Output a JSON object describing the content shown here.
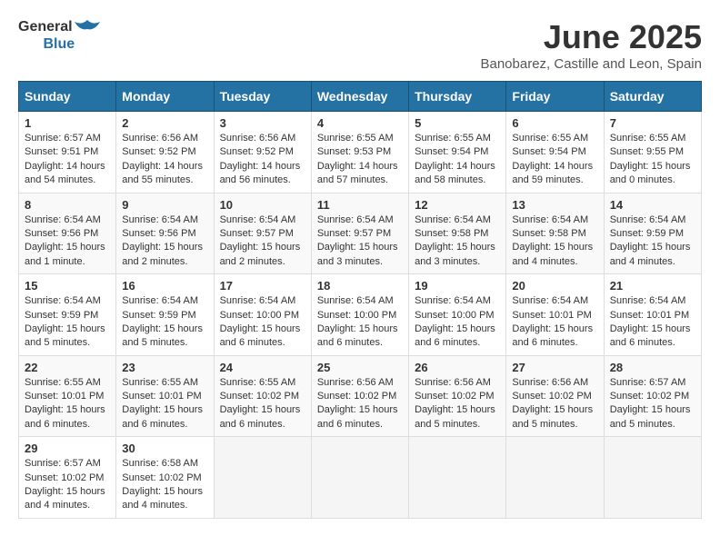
{
  "logo": {
    "general": "General",
    "blue": "Blue"
  },
  "title": "June 2025",
  "subtitle": "Banobarez, Castille and Leon, Spain",
  "days_header": [
    "Sunday",
    "Monday",
    "Tuesday",
    "Wednesday",
    "Thursday",
    "Friday",
    "Saturday"
  ],
  "weeks": [
    [
      {
        "day": "1",
        "sunrise": "6:57 AM",
        "sunset": "9:51 PM",
        "daylight": "14 hours and 54 minutes."
      },
      {
        "day": "2",
        "sunrise": "6:56 AM",
        "sunset": "9:52 PM",
        "daylight": "14 hours and 55 minutes."
      },
      {
        "day": "3",
        "sunrise": "6:56 AM",
        "sunset": "9:52 PM",
        "daylight": "14 hours and 56 minutes."
      },
      {
        "day": "4",
        "sunrise": "6:55 AM",
        "sunset": "9:53 PM",
        "daylight": "14 hours and 57 minutes."
      },
      {
        "day": "5",
        "sunrise": "6:55 AM",
        "sunset": "9:54 PM",
        "daylight": "14 hours and 58 minutes."
      },
      {
        "day": "6",
        "sunrise": "6:55 AM",
        "sunset": "9:54 PM",
        "daylight": "14 hours and 59 minutes."
      },
      {
        "day": "7",
        "sunrise": "6:55 AM",
        "sunset": "9:55 PM",
        "daylight": "15 hours and 0 minutes."
      }
    ],
    [
      {
        "day": "8",
        "sunrise": "6:54 AM",
        "sunset": "9:56 PM",
        "daylight": "15 hours and 1 minute."
      },
      {
        "day": "9",
        "sunrise": "6:54 AM",
        "sunset": "9:56 PM",
        "daylight": "15 hours and 2 minutes."
      },
      {
        "day": "10",
        "sunrise": "6:54 AM",
        "sunset": "9:57 PM",
        "daylight": "15 hours and 2 minutes."
      },
      {
        "day": "11",
        "sunrise": "6:54 AM",
        "sunset": "9:57 PM",
        "daylight": "15 hours and 3 minutes."
      },
      {
        "day": "12",
        "sunrise": "6:54 AM",
        "sunset": "9:58 PM",
        "daylight": "15 hours and 3 minutes."
      },
      {
        "day": "13",
        "sunrise": "6:54 AM",
        "sunset": "9:58 PM",
        "daylight": "15 hours and 4 minutes."
      },
      {
        "day": "14",
        "sunrise": "6:54 AM",
        "sunset": "9:59 PM",
        "daylight": "15 hours and 4 minutes."
      }
    ],
    [
      {
        "day": "15",
        "sunrise": "6:54 AM",
        "sunset": "9:59 PM",
        "daylight": "15 hours and 5 minutes."
      },
      {
        "day": "16",
        "sunrise": "6:54 AM",
        "sunset": "9:59 PM",
        "daylight": "15 hours and 5 minutes."
      },
      {
        "day": "17",
        "sunrise": "6:54 AM",
        "sunset": "10:00 PM",
        "daylight": "15 hours and 6 minutes."
      },
      {
        "day": "18",
        "sunrise": "6:54 AM",
        "sunset": "10:00 PM",
        "daylight": "15 hours and 6 minutes."
      },
      {
        "day": "19",
        "sunrise": "6:54 AM",
        "sunset": "10:00 PM",
        "daylight": "15 hours and 6 minutes."
      },
      {
        "day": "20",
        "sunrise": "6:54 AM",
        "sunset": "10:01 PM",
        "daylight": "15 hours and 6 minutes."
      },
      {
        "day": "21",
        "sunrise": "6:54 AM",
        "sunset": "10:01 PM",
        "daylight": "15 hours and 6 minutes."
      }
    ],
    [
      {
        "day": "22",
        "sunrise": "6:55 AM",
        "sunset": "10:01 PM",
        "daylight": "15 hours and 6 minutes."
      },
      {
        "day": "23",
        "sunrise": "6:55 AM",
        "sunset": "10:01 PM",
        "daylight": "15 hours and 6 minutes."
      },
      {
        "day": "24",
        "sunrise": "6:55 AM",
        "sunset": "10:02 PM",
        "daylight": "15 hours and 6 minutes."
      },
      {
        "day": "25",
        "sunrise": "6:56 AM",
        "sunset": "10:02 PM",
        "daylight": "15 hours and 6 minutes."
      },
      {
        "day": "26",
        "sunrise": "6:56 AM",
        "sunset": "10:02 PM",
        "daylight": "15 hours and 5 minutes."
      },
      {
        "day": "27",
        "sunrise": "6:56 AM",
        "sunset": "10:02 PM",
        "daylight": "15 hours and 5 minutes."
      },
      {
        "day": "28",
        "sunrise": "6:57 AM",
        "sunset": "10:02 PM",
        "daylight": "15 hours and 5 minutes."
      }
    ],
    [
      {
        "day": "29",
        "sunrise": "6:57 AM",
        "sunset": "10:02 PM",
        "daylight": "15 hours and 4 minutes."
      },
      {
        "day": "30",
        "sunrise": "6:58 AM",
        "sunset": "10:02 PM",
        "daylight": "15 hours and 4 minutes."
      },
      null,
      null,
      null,
      null,
      null
    ]
  ],
  "labels": {
    "sunrise": "Sunrise:",
    "sunset": "Sunset:",
    "daylight": "Daylight:"
  }
}
